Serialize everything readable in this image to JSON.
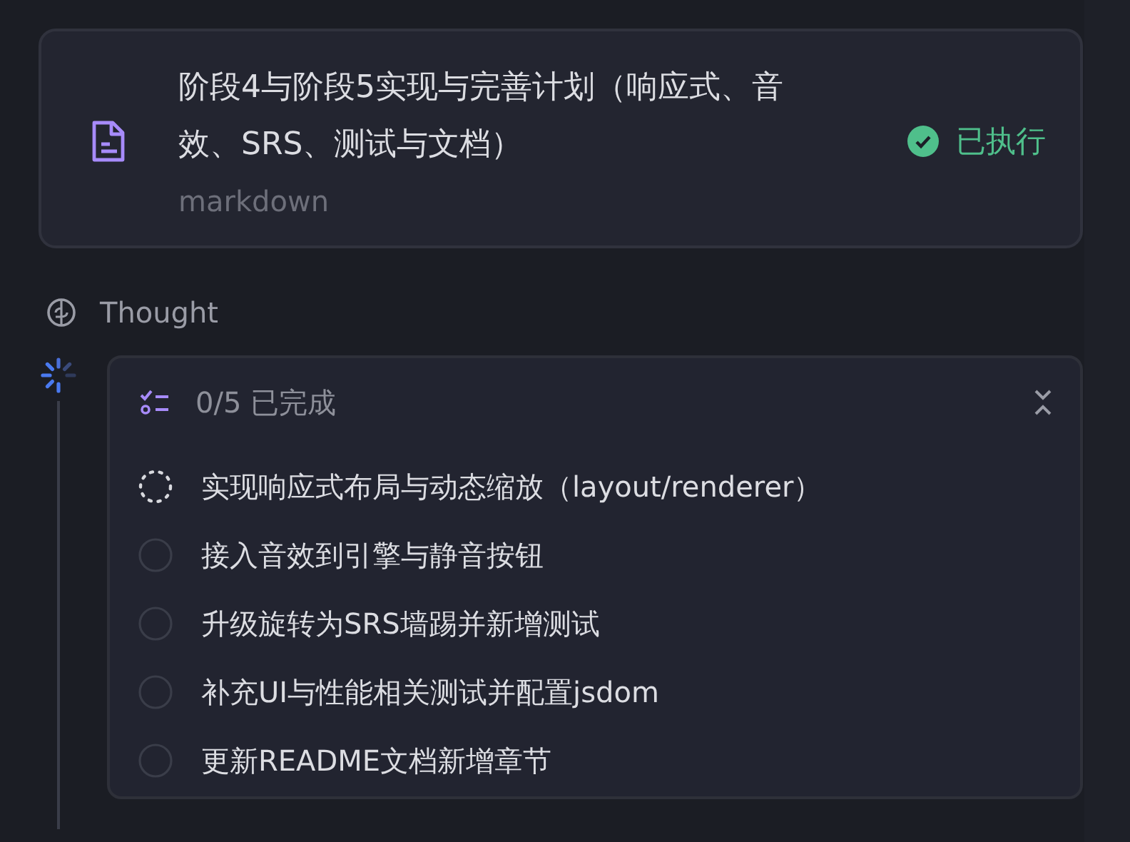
{
  "file_card": {
    "title": "阶段4与阶段5实现与完善计划（响应式、音效、SRS、测试与文档）",
    "type": "markdown",
    "status": {
      "label": "已执行",
      "done": true
    }
  },
  "thought": {
    "label": "Thought"
  },
  "todo": {
    "summary": "0/5 已完成",
    "expanded": true,
    "items": [
      {
        "text": "实现响应式布局与动态缩放（layout/renderer）",
        "kind": "in_progress"
      },
      {
        "text": "接入音效到引擎与静音按钮",
        "kind": "pending"
      },
      {
        "text": "升级旋转为SRS墙踢并新增测试",
        "kind": "pending"
      },
      {
        "text": "补充UI与性能相关测试并配置jsdom",
        "kind": "pending"
      },
      {
        "text": "更新README文档新增章节",
        "kind": "pending"
      }
    ]
  }
}
